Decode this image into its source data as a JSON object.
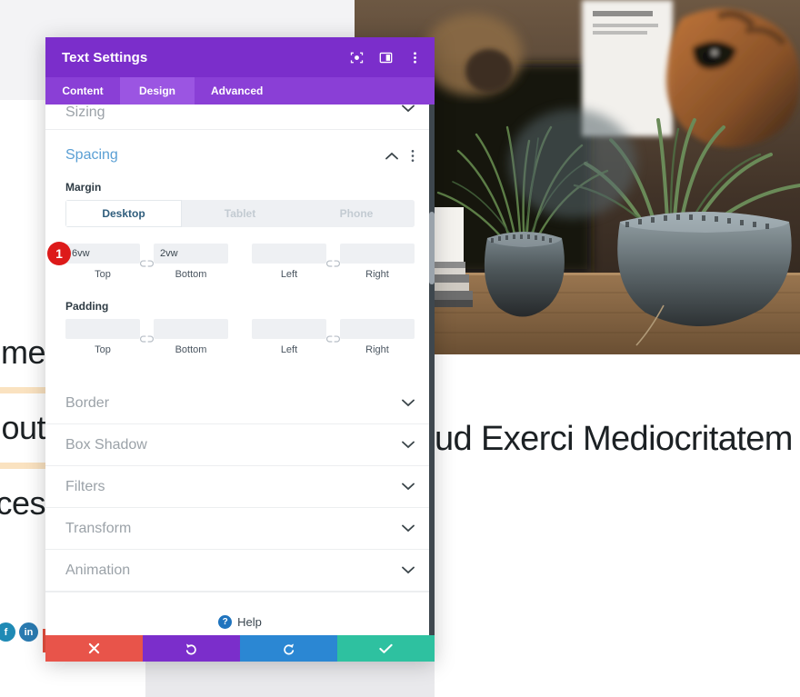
{
  "background": {
    "nav_items": [
      "me",
      "out",
      "ices"
    ],
    "heading": "ud Exerci Mediocritatem",
    "social": [
      {
        "name": "facebook-icon",
        "glyph": "f"
      },
      {
        "name": "linkedin-icon",
        "glyph": "in"
      }
    ]
  },
  "modal": {
    "title": "Text Settings",
    "header_icons": [
      {
        "name": "focus-target-icon"
      },
      {
        "name": "panel-layout-icon"
      },
      {
        "name": "more-options-icon"
      }
    ],
    "tabs": [
      {
        "label": "Content",
        "active": false
      },
      {
        "label": "Design",
        "active": true
      },
      {
        "label": "Advanced",
        "active": false
      }
    ],
    "sections": {
      "sizing": {
        "label": "Sizing",
        "state": "collapsed"
      },
      "spacing": {
        "label": "Spacing",
        "state": "expanded"
      },
      "collapsed_list": [
        {
          "label": "Border"
        },
        {
          "label": "Box Shadow"
        },
        {
          "label": "Filters"
        },
        {
          "label": "Transform"
        },
        {
          "label": "Animation"
        }
      ]
    },
    "spacing": {
      "margin_label": "Margin",
      "padding_label": "Padding",
      "device_tabs": [
        {
          "label": "Desktop",
          "active": true
        },
        {
          "label": "Tablet",
          "active": false
        },
        {
          "label": "Phone",
          "active": false
        }
      ],
      "badge": "1",
      "margin": {
        "top": {
          "label": "Top",
          "value": "6vw"
        },
        "bottom": {
          "label": "Bottom",
          "value": "2vw"
        },
        "left": {
          "label": "Left",
          "value": ""
        },
        "right": {
          "label": "Right",
          "value": ""
        }
      },
      "padding": {
        "top": {
          "label": "Top",
          "value": ""
        },
        "bottom": {
          "label": "Bottom",
          "value": ""
        },
        "left": {
          "label": "Left",
          "value": ""
        },
        "right": {
          "label": "Right",
          "value": ""
        }
      },
      "link_icon_name": "unlinked-chain-icon"
    },
    "help": {
      "label": "Help",
      "icon": "question-mark-icon"
    },
    "footer": [
      {
        "name": "cancel-button",
        "icon": "close-x-icon",
        "color": "#e8544a"
      },
      {
        "name": "undo-button",
        "icon": "undo-arrow-icon",
        "color": "#7b2ecb"
      },
      {
        "name": "redo-button",
        "icon": "redo-arrow-icon",
        "color": "#2b87d3"
      },
      {
        "name": "save-button",
        "icon": "checkmark-icon",
        "color": "#2ec1a0"
      }
    ]
  },
  "colors": {
    "header_purple": "#7b2ecb",
    "tabbar_purple": "#8a3fd6",
    "active_tab_purple": "#9b55e2",
    "accent_blue": "#5a9fd4",
    "badge_red": "#dd1a1a",
    "highlight_tan": "#fae2c0"
  }
}
